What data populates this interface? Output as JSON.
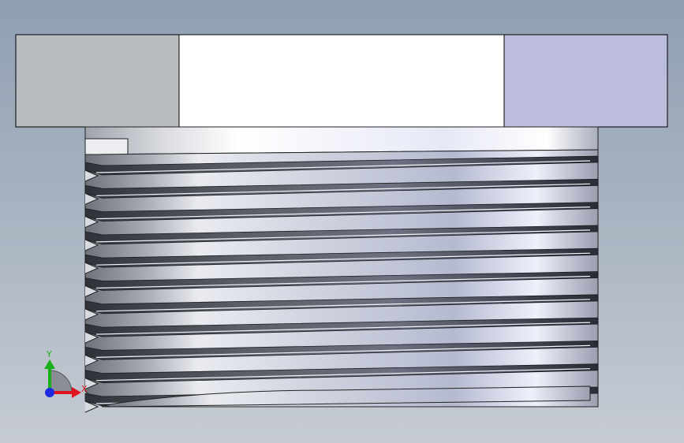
{
  "viewport": {
    "background_top": "#8f9fb2",
    "background_bottom": "#c6cbd3"
  },
  "model": {
    "head_left_face_color": "#b8bcc1",
    "head_front_face_color": "#ffffff",
    "head_right_face_color": "#bcbddc",
    "thread_count": 11
  },
  "triad": {
    "x_label": "X",
    "y_label": "Y",
    "x_color": "#e0141e",
    "y_color": "#18b018",
    "z_color": "#1c2ae0"
  }
}
